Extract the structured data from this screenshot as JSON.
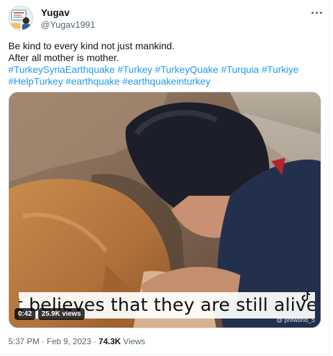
{
  "author": {
    "display_name": "Yugav",
    "handle": "@Yugav1991"
  },
  "tweet": {
    "text_lines": [
      "Be kind to every kind not just mankind.",
      "After all mother is mother."
    ],
    "hashtags_line1": [
      "#TurkeySyriaEarthquake",
      "#Turkey",
      "#TurkeyQuake",
      "#Turquia",
      "#Turkiye"
    ],
    "hashtags_line2": [
      "#HelpTurkey",
      "#earthquake",
      "#earthquakeinturkey"
    ]
  },
  "media": {
    "caption": "It believes that they are still alive.",
    "duration": "0:42",
    "views_badge": "25.9K views",
    "watermark": "@ pnfworld_5"
  },
  "footer": {
    "time": "5:37 PM",
    "separator": "·",
    "date": "Feb 9, 2023",
    "views_count": "74.3K",
    "views_label": "Views"
  },
  "colors": {
    "link": "#1d9bf0",
    "text": "#0f1419",
    "secondary": "#536471"
  },
  "icons": [
    "more-options-icon",
    "tiktok-icon"
  ]
}
